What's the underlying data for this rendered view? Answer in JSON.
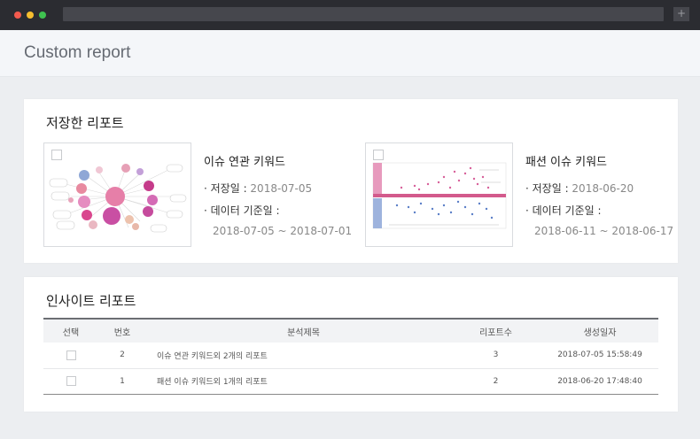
{
  "browser": {
    "new_tab_label": "+"
  },
  "page": {
    "title": "Custom report"
  },
  "saved_reports": {
    "title": "저장한 리포트",
    "items": [
      {
        "name": "이슈 연관 키워드",
        "saved_label": "· 저장일 : ",
        "saved_date": "2018-07-05",
        "basis_label": "· 데이터 기준일 :",
        "basis_range": "2018-07-05 ~ 2018-07-01"
      },
      {
        "name": "패션 이슈 키워드",
        "saved_label": "· 저장일 : ",
        "saved_date": "2018-06-20",
        "basis_label": "· 데이터 기준일 :",
        "basis_range": "2018-06-11 ~ 2018-06-17"
      }
    ]
  },
  "insight_reports": {
    "title": "인사이트 리포트",
    "columns": {
      "select": "선택",
      "number": "번호",
      "title": "분석제목",
      "count": "리포트수",
      "created": "생성일자"
    },
    "rows": [
      {
        "number": "2",
        "title": "이슈 연관 키워드외 2개의 리포트",
        "count": "3",
        "created": "2018-07-05  15:58:49"
      },
      {
        "number": "1",
        "title": "패션 이슈 키워드외 1개의 리포트",
        "count": "2",
        "created": "2018-06-20  17:48:40"
      }
    ]
  },
  "colors": {
    "titlebar": "#2b2c31",
    "page_bg": "#eceef1",
    "header_bg": "#f4f6f9"
  }
}
